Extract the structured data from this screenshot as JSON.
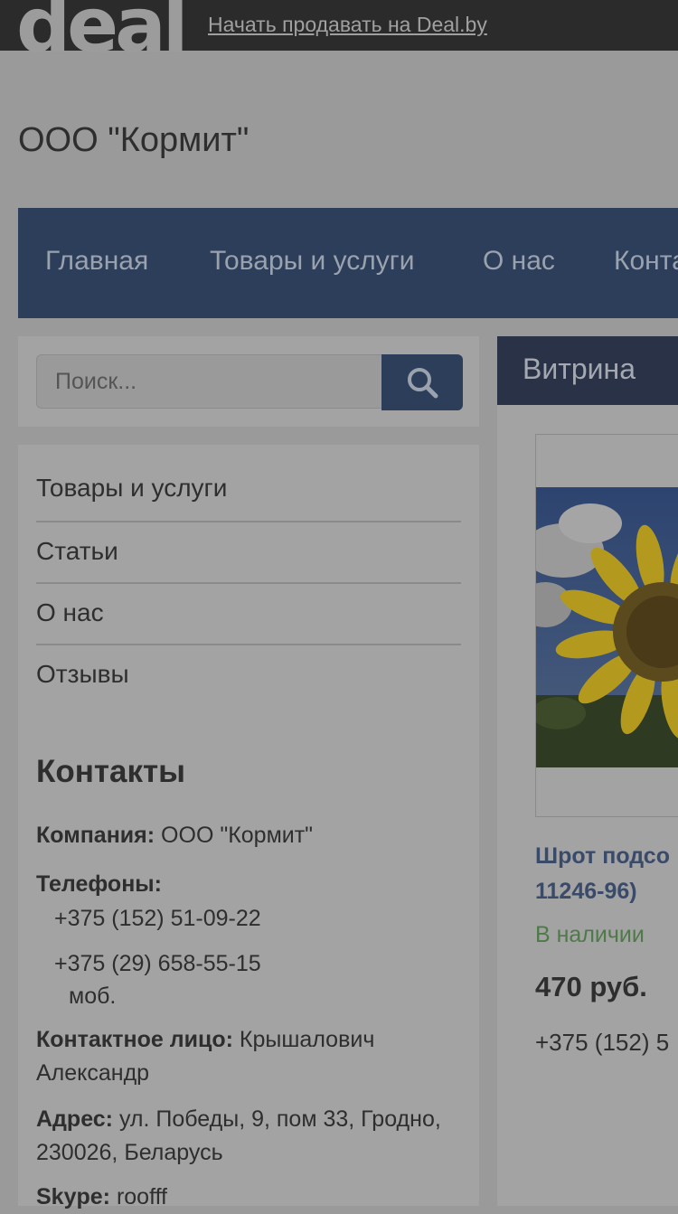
{
  "topbar": {
    "logo": "deal",
    "sell_link": "Начать продавать на Deal.by"
  },
  "company_name": "ООО \"Кормит\"",
  "nav": {
    "items": [
      "Главная",
      "Товары и услуги",
      "О нас",
      "Конта"
    ]
  },
  "search": {
    "placeholder": "Поиск...",
    "icon": "search-icon"
  },
  "sidebar": {
    "items": [
      "Товары и услуги",
      "Статьи",
      "О нас",
      "Отзывы"
    ]
  },
  "contacts": {
    "title": "Контакты",
    "company_label": "Компания:",
    "company_value": "ООО \"Кормит\"",
    "phones_label": "Телефоны:",
    "phone1": "+375 (152) 51-09-22",
    "phone2": "+375 (29) 658-55-15",
    "phone2_note": "моб.",
    "person_label": "Контактное лицо:",
    "person_value": "Крышалович Александр",
    "address_label": "Адрес:",
    "address_value": "ул. Победы, 9, пом 33, Гродно, 230026, Беларусь",
    "skype_label": "Skype:",
    "skype_value": "roofff"
  },
  "showcase": {
    "header": "Витрина",
    "product": {
      "title_line1": "Шрот подсо",
      "title_line2": "11246-96)",
      "stock": "В наличии",
      "price": "470 руб.",
      "phone": "+375 (152) 5"
    }
  },
  "colors": {
    "topbar": "#2b2b2b",
    "nav": "#2d3e5b",
    "showcase_header": "#2a3247",
    "in_stock": "#4e7a48",
    "product_link": "#3a4b6a"
  }
}
